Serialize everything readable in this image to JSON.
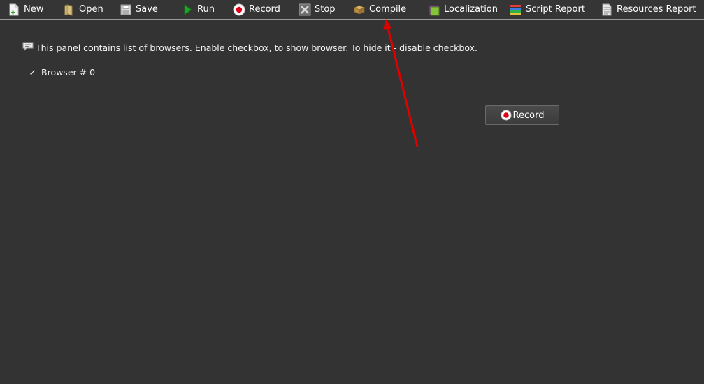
{
  "toolbar": {
    "items": [
      {
        "label": "New",
        "icon": "new-file-icon"
      },
      {
        "label": "Open",
        "icon": "open-folder-icon"
      },
      {
        "label": "Save",
        "icon": "save-icon"
      },
      {
        "label": "Run",
        "icon": "run-icon"
      },
      {
        "label": "Record",
        "icon": "record-icon"
      },
      {
        "label": "Stop",
        "icon": "stop-icon"
      },
      {
        "label": "Compile",
        "icon": "compile-icon"
      },
      {
        "label": "Localization",
        "icon": "localization-icon"
      },
      {
        "label": "Script Report",
        "icon": "script-report-icon"
      },
      {
        "label": "Resources Report",
        "icon": "resources-report-icon"
      }
    ]
  },
  "panel": {
    "info_text": "This panel contains list of browsers. Enable checkbox, to show browser. To hide it - disable checkbox.",
    "browsers": [
      {
        "label": "Browser # 0",
        "checked": true
      }
    ],
    "record_button_label": "Record"
  },
  "colors": {
    "background": "#333333",
    "record_red": "#e0001a",
    "annotation_arrow": "#e00000"
  }
}
